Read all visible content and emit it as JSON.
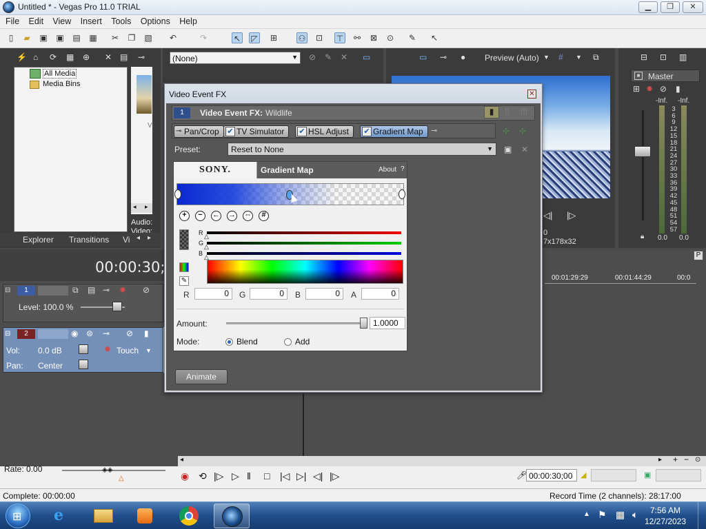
{
  "window": {
    "title": "Untitled * - Vegas Pro 11.0 TRIAL",
    "min": "▁",
    "max": "❐",
    "close": "✕"
  },
  "menu": [
    "File",
    "Edit",
    "View",
    "Insert",
    "Tools",
    "Options",
    "Help"
  ],
  "explorer": {
    "items": [
      "All Media",
      "Media Bins"
    ],
    "tabs": [
      "Explorer",
      "Transitions",
      "Vi"
    ],
    "audio_label": "Audio:",
    "video_label": "Video:",
    "thumb_label": "V"
  },
  "trimmer": {
    "select_value": "(None)"
  },
  "preview": {
    "mode": "Preview (Auto)",
    "frame": "0",
    "size_text": "7x178x32"
  },
  "master": {
    "title": "Master",
    "neg_inf_l": "-Inf.",
    "neg_inf_r": "-Inf.",
    "scale": [
      "3",
      "6",
      "9",
      "12",
      "15",
      "18",
      "21",
      "24",
      "27",
      "30",
      "33",
      "36",
      "39",
      "42",
      "45",
      "48",
      "51",
      "54",
      "57"
    ],
    "val_l": "0.0",
    "val_r": "0.0"
  },
  "timeline": {
    "timecode": "00:00:30;0",
    "ticks": [
      "00:01:29:29",
      "00:01:44:29",
      "00:0"
    ],
    "track1": {
      "num": "1",
      "level": "Level: 100.0 %"
    },
    "track2": {
      "num": "2",
      "vol_label": "Vol:",
      "vol_value": "0.0 dB",
      "pan_label": "Pan:",
      "pan_value": "Center",
      "touch": "Touch"
    },
    "rate": "Rate: 0.00",
    "transport_time": "00:00:30;00",
    "record_time": "Record Time (2 channels): 28:17:00",
    "complete": "Complete: 00:00:00"
  },
  "dialog": {
    "title": "Video Event FX",
    "fx_label": "Video Event FX:",
    "fx_name": "Wildlife",
    "fx_num": "1",
    "chain": [
      {
        "label": "Pan/Crop",
        "checked": false
      },
      {
        "label": "TV Simulator",
        "checked": true
      },
      {
        "label": "HSL Adjust",
        "checked": true
      },
      {
        "label": "Gradient Map",
        "checked": true,
        "active": true
      }
    ],
    "preset_label": "Preset:",
    "preset_value": "Reset to None",
    "plugin": {
      "brand": "SONY.",
      "name": "Gradient Map",
      "about": "About",
      "help": "?",
      "channels": [
        "R",
        "G",
        "B"
      ],
      "channel_colors": [
        "#e00000",
        "#00c000",
        "#0000d0"
      ],
      "fields": [
        {
          "label": "R",
          "value": "0"
        },
        {
          "label": "G",
          "value": "0"
        },
        {
          "label": "B",
          "value": "0"
        },
        {
          "label": "A",
          "value": "0"
        }
      ],
      "amount_label": "Amount:",
      "amount_value": "1.0000",
      "amount_fraction": 1.0,
      "mode_label": "Mode:",
      "mode_options": [
        "Blend",
        "Add"
      ],
      "mode_selected": "Blend"
    },
    "animate": "Animate"
  },
  "taskbar": {
    "time": "7:56 AM",
    "date": "12/27/2023"
  }
}
